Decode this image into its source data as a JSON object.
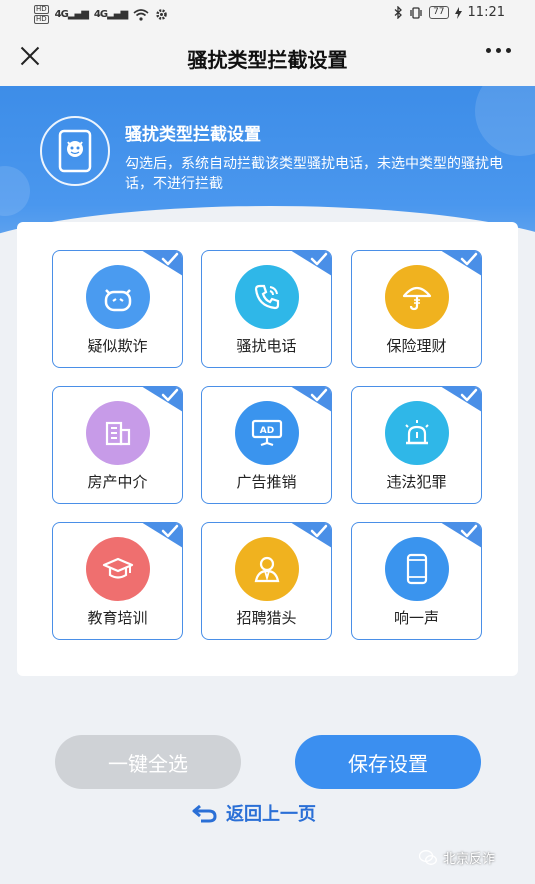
{
  "status_bar": {
    "hd1": "HD",
    "hd2": "HD",
    "signal1": "4G",
    "signal2": "4G",
    "battery": "77",
    "time": "11:21"
  },
  "title_bar": {
    "title": "骚扰类型拦截设置"
  },
  "banner": {
    "title": "骚扰类型拦截设置",
    "description": "勾选后，系统自动拦截该类型骚扰电话，未选中类型的骚扰电话，不进行拦截"
  },
  "categories": [
    {
      "label": "疑似欺诈",
      "icon": "robot-face-icon",
      "color": "#4a9bf0",
      "checked": true
    },
    {
      "label": "骚扰电话",
      "icon": "phone-icon",
      "color": "#2fb7e8",
      "checked": true
    },
    {
      "label": "保险理财",
      "icon": "umbrella-icon",
      "color": "#f0b21f",
      "checked": true
    },
    {
      "label": "房产中介",
      "icon": "building-icon",
      "color": "#c79be8",
      "checked": true
    },
    {
      "label": "广告推销",
      "icon": "ad-board-icon",
      "color": "#3a94ee",
      "checked": true
    },
    {
      "label": "违法犯罪",
      "icon": "alarm-light-icon",
      "color": "#2fb7e8",
      "checked": true
    },
    {
      "label": "教育培训",
      "icon": "graduation-cap-icon",
      "color": "#ef6f6f",
      "checked": true
    },
    {
      "label": "招聘猎头",
      "icon": "person-icon",
      "color": "#f0b21f",
      "checked": true
    },
    {
      "label": "响一声",
      "icon": "mobile-phone-icon",
      "color": "#3a94ee",
      "checked": true
    }
  ],
  "actions": {
    "select_all": "一键全选",
    "save": "保存设置",
    "back": "返回上一页"
  },
  "watermark": "北京反诈"
}
